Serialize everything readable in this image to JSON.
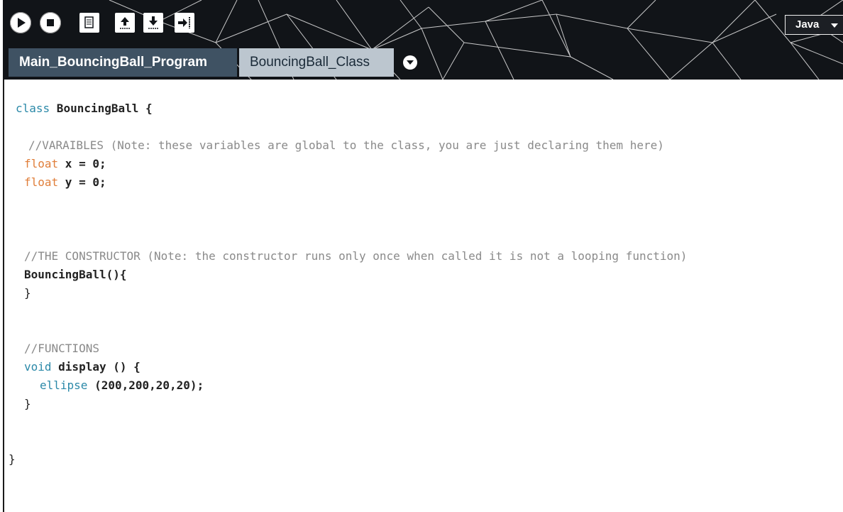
{
  "toolbar": {
    "run_icon": "play-icon",
    "stop_icon": "stop-icon",
    "new_icon": "document-icon",
    "upload_icon": "upload-icon",
    "download_icon": "download-icon",
    "export_icon": "export-arrow-icon",
    "language": "Java"
  },
  "tabs": [
    {
      "label": "Main_BouncingBall_Program",
      "active": true
    },
    {
      "label": "BouncingBall_Class",
      "active": false
    }
  ],
  "code": {
    "l1_kw": "class",
    "l1_rest": " BouncingBall {",
    "l2_comment": "//VARAIBLES (Note: these variables are global to the class, you are just declaring them here)",
    "l3_type": "float",
    "l3_rest": " x = 0;",
    "l4_type": "float",
    "l4_rest": " y = 0;",
    "l5_comment": "//THE CONSTRUCTOR (Note: the constructor runs only once when called it is not a looping function)",
    "l6": "BouncingBall(){",
    "l7": "}",
    "l8_comment": "//FUNCTIONS",
    "l9_kw": "void",
    "l9_rest": " display () {",
    "l10_fn": "ellipse",
    "l10_rest": " (200,200,20,20);",
    "l11": "}",
    "l12": "}"
  },
  "colors": {
    "keyword_class": "#2b89a8",
    "keyword_type": "#e07e3a",
    "comment": "#8a8a8a",
    "tab_active_bg": "#3f5263",
    "tab_inactive_bg": "#bcc6cf",
    "header_bg": "#111418"
  }
}
